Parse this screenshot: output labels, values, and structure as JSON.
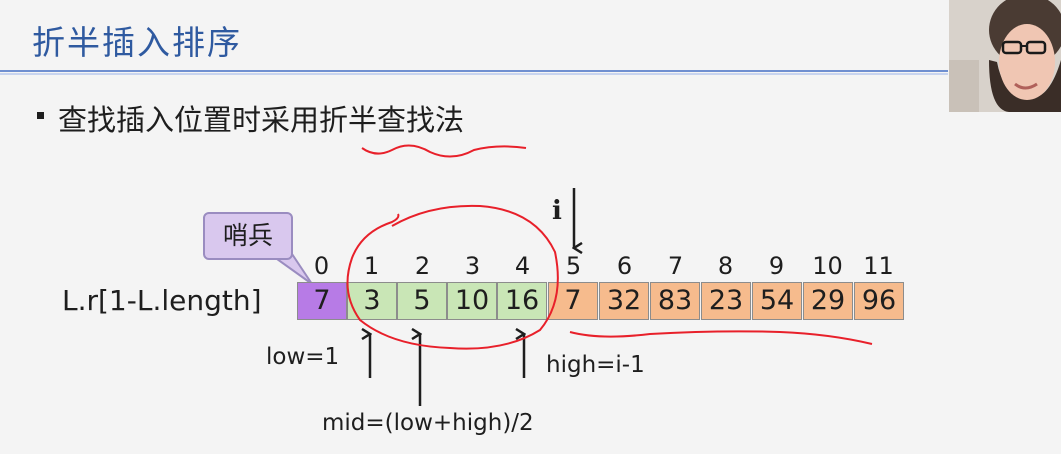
{
  "slide": {
    "title": "折半插入排序",
    "bullet": "查找插入位置时采用折半查找法"
  },
  "callout": {
    "text": "哨兵"
  },
  "array": {
    "label": "L.r[1-L.length]",
    "indices": [
      "0",
      "1",
      "2",
      "3",
      "4",
      "5",
      "6",
      "7",
      "8",
      "9",
      "10",
      "11"
    ],
    "values": [
      "7",
      "3",
      "5",
      "10",
      "16",
      "7",
      "32",
      "83",
      "23",
      "54",
      "29",
      "96"
    ]
  },
  "pointers": {
    "i": "i",
    "low": "low=1",
    "high": "high=i-1",
    "mid": "mid=(low+high)/2"
  },
  "colors": {
    "title": "#2f5aa0",
    "sentinel": "#b77be6",
    "sorted": "#c9e6b6",
    "unsorted": "#f6bb8d",
    "annotation": "#e8202a"
  }
}
